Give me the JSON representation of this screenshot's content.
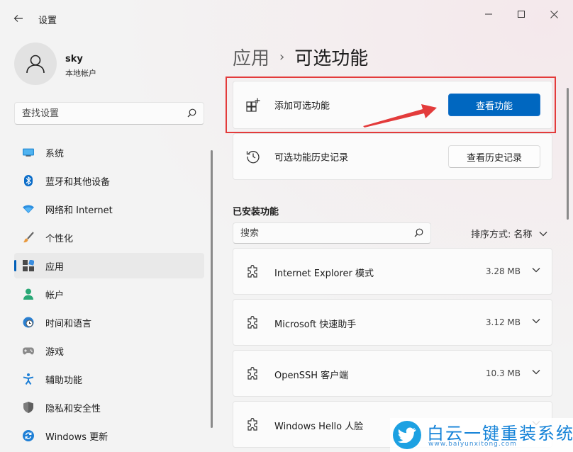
{
  "window": {
    "title": "设置"
  },
  "user": {
    "name": "sky",
    "account_type": "本地帐户"
  },
  "sidebar": {
    "search_placeholder": "查找设置",
    "items": [
      {
        "label": "系统",
        "icon": "system-icon",
        "active": false
      },
      {
        "label": "蓝牙和其他设备",
        "icon": "bluetooth-icon",
        "active": false
      },
      {
        "label": "网络和 Internet",
        "icon": "wifi-icon",
        "active": false
      },
      {
        "label": "个性化",
        "icon": "brush-icon",
        "active": false
      },
      {
        "label": "应用",
        "icon": "apps-icon",
        "active": true
      },
      {
        "label": "帐户",
        "icon": "account-icon",
        "active": false
      },
      {
        "label": "时间和语言",
        "icon": "globe-clock-icon",
        "active": false
      },
      {
        "label": "游戏",
        "icon": "gamepad-icon",
        "active": false
      },
      {
        "label": "辅助功能",
        "icon": "accessibility-icon",
        "active": false
      },
      {
        "label": "隐私和安全性",
        "icon": "shield-icon",
        "active": false
      },
      {
        "label": "Windows 更新",
        "icon": "update-icon",
        "active": false
      }
    ]
  },
  "breadcrumb": {
    "parent": "应用",
    "separator": "›",
    "current": "可选功能"
  },
  "add_feature": {
    "label": "添加可选功能",
    "button": "查看功能"
  },
  "history": {
    "label": "可选功能历史记录",
    "button": "查看历史记录"
  },
  "installed": {
    "title": "已安装功能",
    "search_placeholder": "搜索",
    "sort_label": "排序方式:",
    "sort_value": "名称",
    "features": [
      {
        "name": "Internet Explorer 模式",
        "size": "3.28 MB"
      },
      {
        "name": "Microsoft 快速助手",
        "size": "3.12 MB"
      },
      {
        "name": "OpenSSH 客户端",
        "size": "10.3 MB"
      },
      {
        "name": "Windows Hello 人脸",
        "size": ""
      }
    ]
  },
  "watermark": {
    "title": "白云一键重装系统",
    "url": "www.baiyunxitong.com"
  },
  "colors": {
    "accent": "#0067c0",
    "highlight": "#e33b3b",
    "background": "#f3f3f3"
  }
}
